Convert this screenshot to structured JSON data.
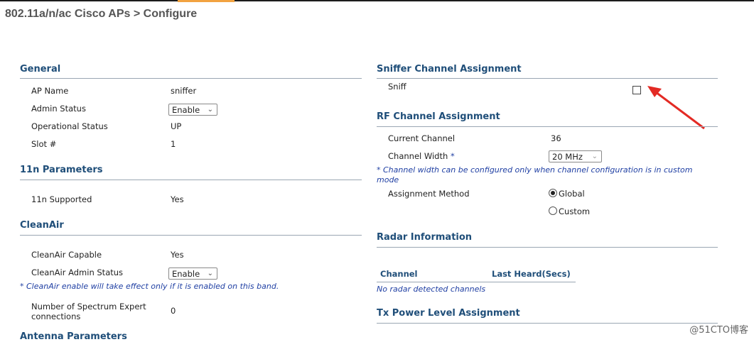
{
  "header": {
    "title": "802.11a/n/ac Cisco APs > Configure"
  },
  "general": {
    "title": "General",
    "ap_name_label": "AP Name",
    "ap_name_value": "sniffer",
    "admin_status_label": "Admin Status",
    "admin_status_value": "Enable",
    "op_status_label": "Operational Status",
    "op_status_value": "UP",
    "slot_label": "Slot #",
    "slot_value": "1"
  },
  "n11": {
    "title": "11n Parameters",
    "supported_label": "11n Supported",
    "supported_value": "Yes"
  },
  "cleanair": {
    "title": "CleanAir",
    "capable_label": "CleanAir Capable",
    "capable_value": "Yes",
    "admin_label": "CleanAir Admin Status",
    "admin_value": "Enable",
    "note": "* CleanAir enable will take effect only if it is enabled on this band.",
    "spectrum_label_1": "Number of Spectrum Expert",
    "spectrum_label_2": "connections",
    "spectrum_value": "0"
  },
  "antenna": {
    "title": "Antenna Parameters"
  },
  "sniffer": {
    "title": "Sniffer Channel Assignment",
    "sniff_label": "Sniff",
    "sniff_checked": false
  },
  "rf": {
    "title": "RF Channel Assignment",
    "current_label": "Current Channel",
    "current_value": "36",
    "width_label": "Channel Width",
    "width_star": "*",
    "width_value": "20 MHz",
    "note_1": "* Channel width can be configured only when channel configuration is in custom",
    "note_2": "mode",
    "method_label": "Assignment Method",
    "option_global": "Global",
    "option_custom": "Custom",
    "selected": "Global"
  },
  "radar": {
    "title": "Radar Information",
    "col_channel": "Channel",
    "col_last_heard": "Last Heard(Secs)",
    "empty_text": "No radar detected channels"
  },
  "tx": {
    "title": "Tx Power Level Assignment"
  },
  "watermark": "@51CTO博客",
  "colors": {
    "section_title": "#1f4e79",
    "note": "#1f3fa3",
    "arrow": "#e32a24",
    "accent": "#f2a341"
  }
}
